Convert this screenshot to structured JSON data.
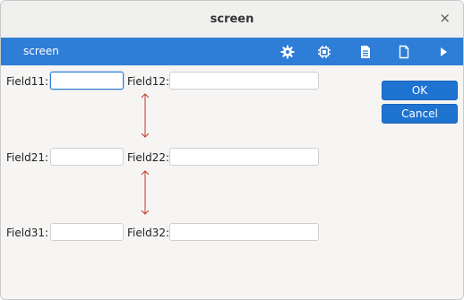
{
  "window": {
    "title": "screen",
    "close_glyph": "×"
  },
  "toolbar": {
    "title": "screen",
    "icons": [
      "gear-icon",
      "chip-icon",
      "document-icon",
      "blank-file-icon",
      "play-icon"
    ]
  },
  "form": {
    "field11_label": "Field11:",
    "field12_label": "Field12:",
    "field21_label": "Field21:",
    "field22_label": "Field22:",
    "field31_label": "Field31:",
    "field32_label": "Field32:",
    "field11_value": "",
    "field12_value": "",
    "field21_value": "",
    "field22_value": "",
    "field31_value": "",
    "field32_value": ""
  },
  "buttons": {
    "ok": "OK",
    "cancel": "Cancel"
  },
  "colors": {
    "accent": "#2e7dd6",
    "arrow": "#c0392b"
  }
}
